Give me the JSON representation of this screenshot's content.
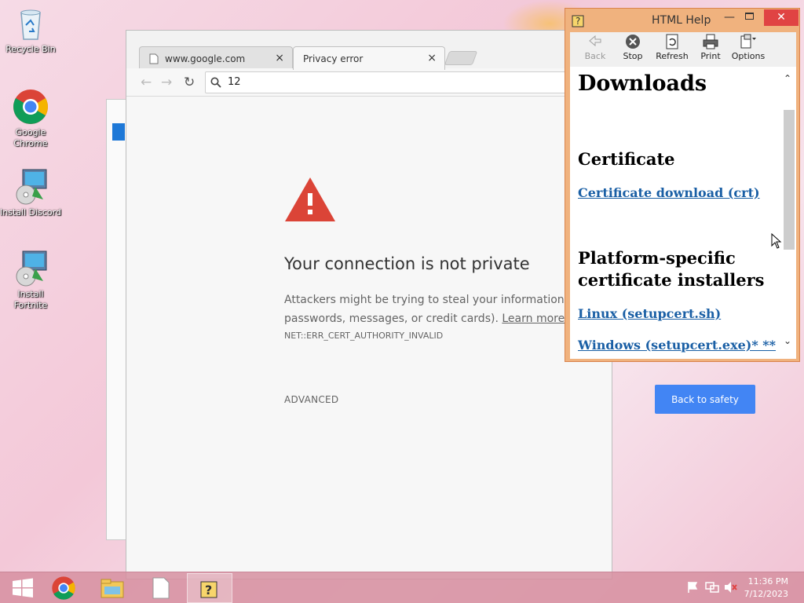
{
  "desktop": {
    "icons": [
      {
        "label": "Recycle Bin",
        "icon": "recycle-bin-icon"
      },
      {
        "label": "Google Chrome",
        "icon": "chrome-icon"
      },
      {
        "label": "Install Discord",
        "icon": "installer-icon"
      },
      {
        "label": "Install Fortnite",
        "icon": "installer-icon"
      }
    ]
  },
  "browser": {
    "tabs": [
      {
        "title": "www.google.com",
        "close": "×"
      },
      {
        "title": "Privacy error",
        "close": "×"
      }
    ],
    "address_value": "12",
    "error": {
      "title": "Your connection is not private",
      "description_line1": "Attackers might be trying to steal your information from",
      "description_line2": "passwords, messages, or credit cards).",
      "learn_more": "Learn more",
      "code": "NET::ERR_CERT_AUTHORITY_INVALID",
      "advanced": "ADVANCED",
      "back_to_safety": "Back to safety"
    },
    "colors": {
      "primary_button": "#4285f4",
      "warning_red": "#db4437"
    }
  },
  "help_window": {
    "title": "HTML Help",
    "toolbar": [
      {
        "label": "Back",
        "icon": "back-arrow-icon",
        "enabled": false
      },
      {
        "label": "Stop",
        "icon": "stop-icon",
        "enabled": true
      },
      {
        "label": "Refresh",
        "icon": "refresh-icon",
        "enabled": true
      },
      {
        "label": "Print",
        "icon": "printer-icon",
        "enabled": true
      },
      {
        "label": "Options",
        "icon": "options-icon",
        "enabled": true
      }
    ],
    "content": {
      "heading_main": "Downloads",
      "section_certificate": "Certificate",
      "link_cert": "Certificate download (crt)",
      "section_platform_line1": "Platform-specific",
      "section_platform_line2": "certificate installers",
      "link_linux": "Linux (setupcert.sh)",
      "link_windows": "Windows (setupcert.exe)* **"
    }
  },
  "taskbar": {
    "items": [
      "start-icon",
      "chrome-icon",
      "file-explorer-icon",
      "document-icon",
      "help-icon"
    ],
    "tray": [
      "flag-icon",
      "network-icon",
      "volume-muted-icon"
    ],
    "time": "11:36 PM",
    "date": "7/12/2023"
  }
}
